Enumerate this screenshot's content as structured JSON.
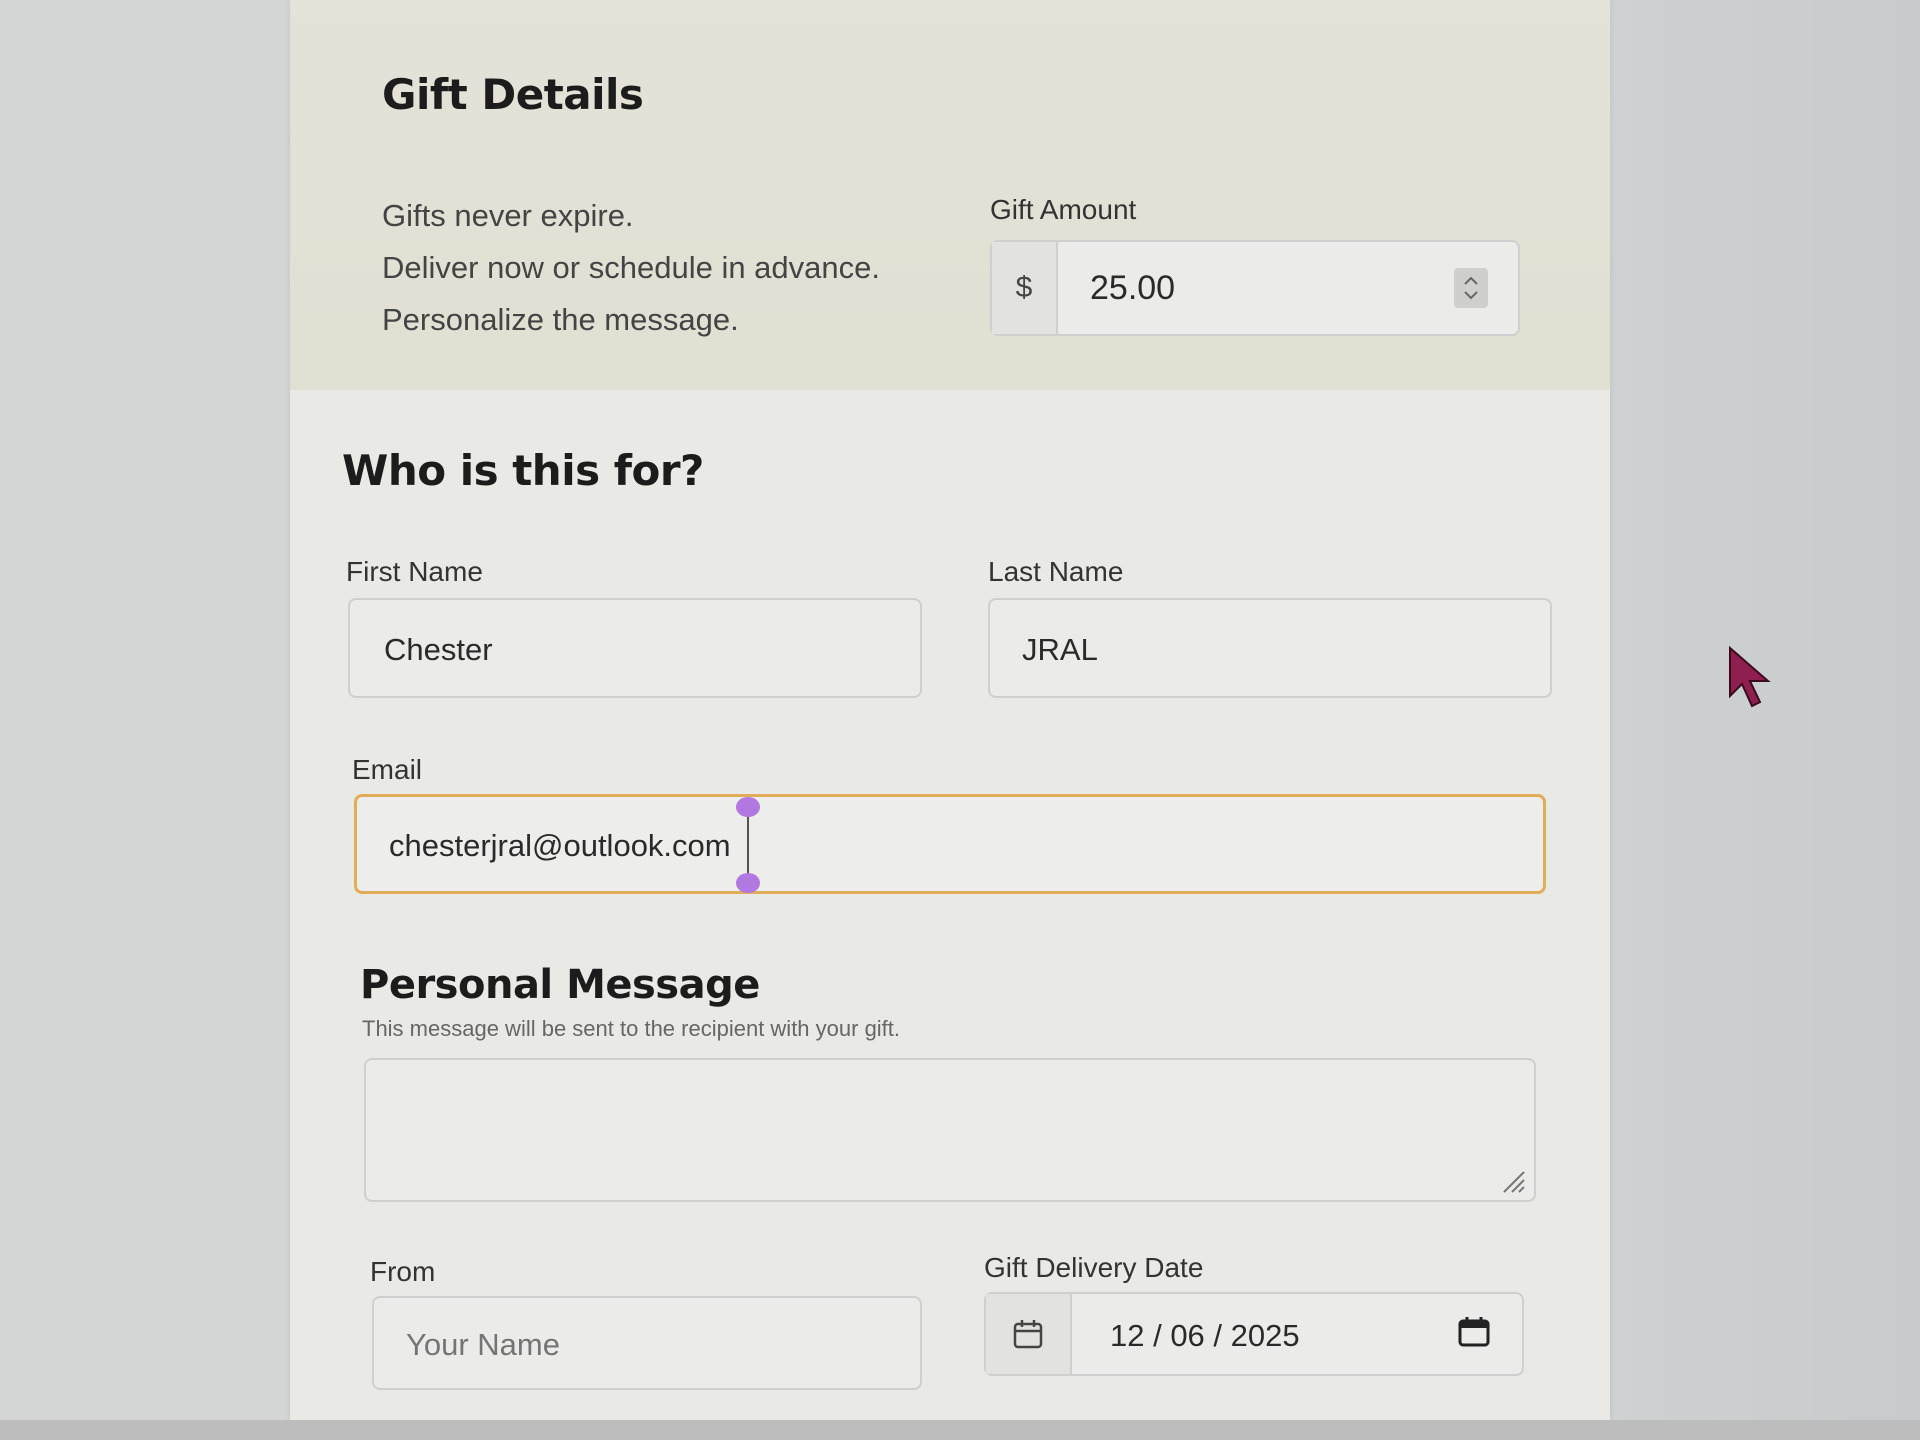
{
  "gift_details": {
    "heading": "Gift Details",
    "perks": [
      "Gifts never expire.",
      "Deliver now or schedule in advance.",
      "Personalize the message."
    ],
    "amount_label": "Gift Amount",
    "currency_symbol": "$",
    "amount_value": "25.00"
  },
  "recipient": {
    "heading": "Who is this for?",
    "first_name_label": "First Name",
    "first_name_value": "Chester",
    "last_name_label": "Last Name",
    "last_name_value": "JRAL",
    "email_label": "Email",
    "email_value": "chesterjral@outlook.com"
  },
  "message": {
    "heading": "Personal Message",
    "helper": "This message will be sent to the recipient with your gift.",
    "value": ""
  },
  "sender": {
    "from_label": "From",
    "from_placeholder": "Your Name",
    "date_label": "Gift Delivery Date",
    "date_value": "12 / 06 / 2025"
  },
  "colors": {
    "focus_border": "#e0ad5a",
    "caret_handle": "#b078e0",
    "mouse_pointer": "#8e1f4e"
  },
  "icons": [
    "spinner-icon",
    "calendar-icon",
    "calendar-picker-icon",
    "resize-grip-icon",
    "mouse-pointer-icon"
  ]
}
